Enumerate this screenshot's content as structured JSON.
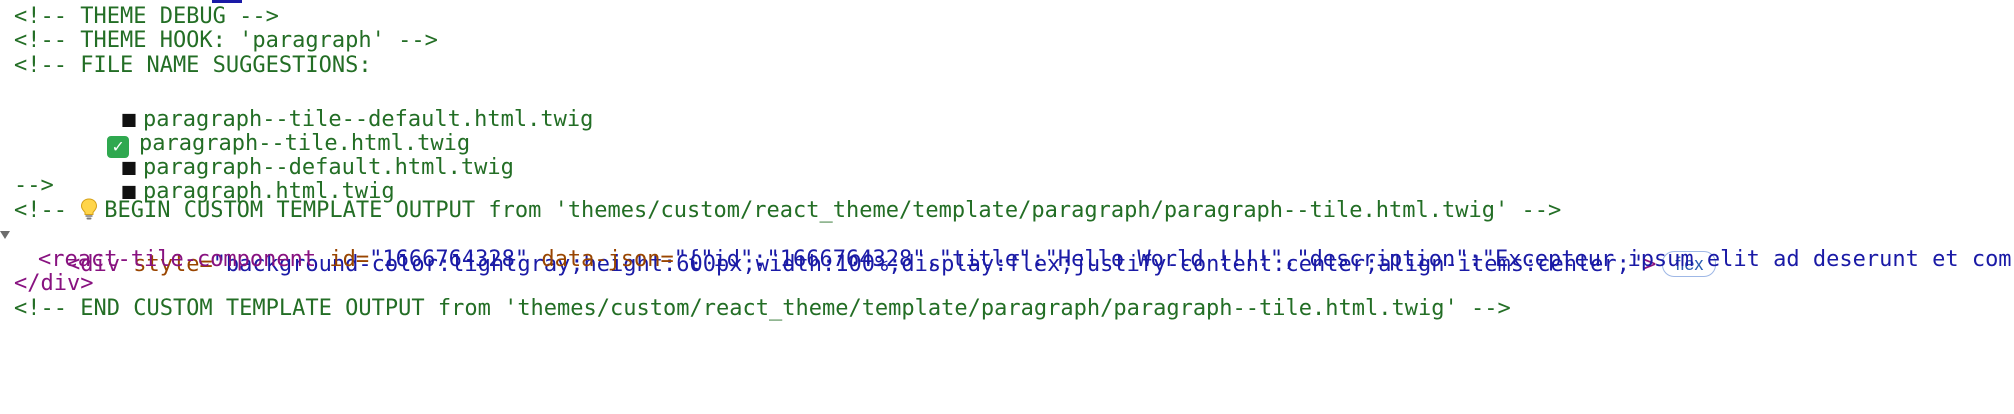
{
  "lines": {
    "theme_debug": "<!-- THEME DEBUG -->",
    "theme_hook": "<!-- THEME HOOK: 'paragraph' -->",
    "file_name_suggestions": "<!-- FILE NAME SUGGESTIONS:",
    "suggestions": [
      {
        "marker": "bullet",
        "text": "paragraph--tile--default.html.twig"
      },
      {
        "marker": "check",
        "text": "paragraph--tile.html.twig"
      },
      {
        "marker": "bullet",
        "text": "paragraph--default.html.twig"
      },
      {
        "marker": "bullet",
        "text": "paragraph.html.twig"
      }
    ],
    "comment_end": "-->",
    "begin_prefix": "<!-- ",
    "begin_text": "BEGIN CUSTOM TEMPLATE OUTPUT from 'themes/custom/react_theme/template/paragraph/paragraph--tile.html.twig' -->",
    "div_open": {
      "tag_open": "<div",
      "attr_name": " style=",
      "attr_value": "\"background-color:lightgray;height:600px;width:100%;display:flex;justify-content:center;align-items:center;\"",
      "tag_close": ">",
      "badge": "flex"
    },
    "react_tile": {
      "tag_open": "<react-tile-component",
      "attr1_name": " id=",
      "attr1_value": "\"1666764328\"",
      "attr2_name": " data-json=",
      "attr2_value": "\"{\"id\":\"1666764328\",\"title\":\"Hello World !!!!\",\"description\":\"Excepteur ipsum elit ad deserunt et com"
    },
    "div_close": "</div>",
    "end_text": "<!-- END CUSTOM TEMPLATE OUTPUT from 'themes/custom/react_theme/template/paragraph/paragraph--tile.html.twig' -->"
  },
  "colors": {
    "comment": "#236e25",
    "tag": "#881280",
    "attr": "#994500",
    "value": "#1a1aa6",
    "check_bg": "#2fa84f"
  },
  "icons": {
    "bullet": "black-square-icon",
    "check": "check-mark-button-icon",
    "bulb": "light-bulb-icon",
    "expand": "expand-triangle-icon"
  }
}
